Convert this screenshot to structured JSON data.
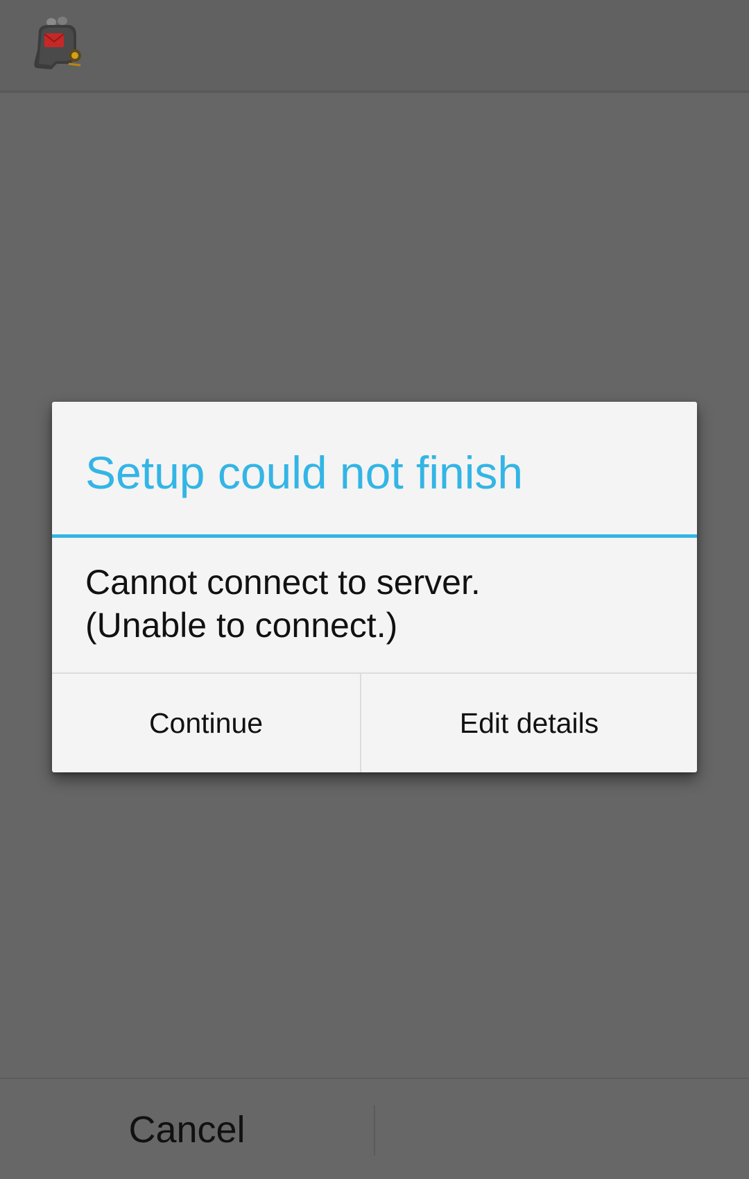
{
  "app": {
    "logo_icon": "mail-robot-logo-icon"
  },
  "dialog": {
    "title": "Setup could not finish",
    "message_line1": "Cannot connect to server.",
    "message_line2": "(Unable to connect.)",
    "continue_label": "Continue",
    "edit_label": "Edit details"
  },
  "bottom_bar": {
    "cancel_label": "Cancel"
  },
  "colors": {
    "accent": "#33b5e5",
    "dim_background": "#666666",
    "dialog_background": "#f4f4f4"
  }
}
